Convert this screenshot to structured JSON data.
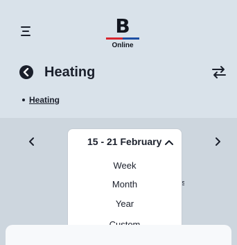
{
  "header": {
    "logo_letter": "B",
    "logo_subtitle": "Online",
    "logo_colors": {
      "red": "#d8262f",
      "blue": "#1d4fa3"
    }
  },
  "page": {
    "title": "Heating"
  },
  "breadcrumb": {
    "items": [
      {
        "label": "Heating"
      }
    ]
  },
  "date_range": {
    "selected": "15 - 21 February",
    "options": [
      "Week",
      "Month",
      "Year",
      "Custom"
    ]
  },
  "peek": {
    "partial_char": "s"
  },
  "icons": {
    "menu": "hamburger-icon",
    "back": "back-circle-icon",
    "swap": "swap-arrows-icon",
    "prev": "chevron-left-icon",
    "next": "chevron-right-icon",
    "caret": "chevron-up-icon"
  },
  "colors": {
    "background": "#d9e2ea",
    "band": "#cdd6de",
    "text": "#1a1f2b",
    "card": "#ffffff"
  }
}
